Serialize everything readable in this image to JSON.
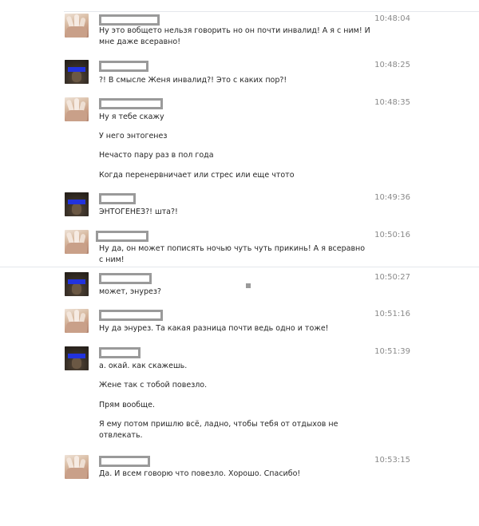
{
  "messages": [
    {
      "avatar": "hand-avatar",
      "time": "10:48:04",
      "lines": [
        "Ну это вобщето нельзя говорить но он почти инвалид! А я с ним! И мне даже всеравно!"
      ]
    },
    {
      "avatar": "dark-avatar",
      "time": "10:48:25",
      "lines": [
        "?! В смысле Женя инвалид?! Это с каких пор?!"
      ]
    },
    {
      "avatar": "hand-avatar",
      "time": "10:48:35",
      "lines": [
        "Ну я тебе скажу",
        "У него энтогенез",
        "Нечасто пару раз в пол года",
        "Когда перенервничает или стрес или еще чтото"
      ]
    },
    {
      "avatar": "dark-avatar",
      "time": "10:49:36",
      "lines": [
        "ЭНТОГЕНЕЗ?! шта?!"
      ]
    },
    {
      "avatar": "hand-avatar",
      "time": "10:50:16",
      "lines": [
        "Ну да, он может пописять ночью чуть чуть прикинь! А я всеравно с ним!"
      ]
    },
    {
      "avatar": "dark-avatar",
      "time": "10:50:27",
      "lines": [
        "может, энурез?"
      ]
    },
    {
      "avatar": "hand-avatar",
      "time": "10:51:16",
      "lines": [
        "Ну да энурез. Та какая разница почти ведь одно и тоже!"
      ]
    },
    {
      "avatar": "dark-avatar",
      "time": "10:51:39",
      "lines": [
        "а. окай. как скажешь.",
        "Жене так с тобой повезло.",
        "Прям вообще.",
        "Я ему потом пришлю всё, ладно, чтобы тебя от отдыхов не отвлекать."
      ]
    },
    {
      "avatar": "hand-avatar",
      "time": "10:53:15",
      "lines": [
        "Да. И всем говорю что повезло. Хорошо. Спасибо!"
      ]
    }
  ]
}
